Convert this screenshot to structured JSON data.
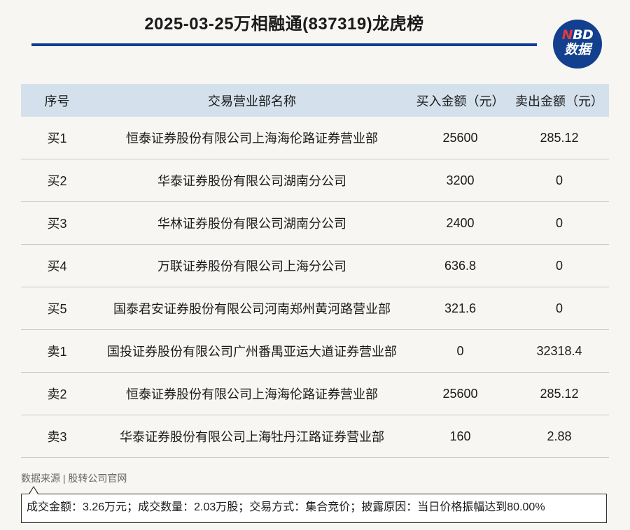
{
  "header": {
    "title": "2025-03-25万相融通(837319)龙虎榜"
  },
  "logo": {
    "line1_n": "N",
    "line1_rest": "BD",
    "line2": "数据"
  },
  "table": {
    "columns": [
      "序号",
      "交易营业部名称",
      "买入金额（元）",
      "卖出金额（元）"
    ],
    "rows": [
      {
        "rank": "买1",
        "name": "恒泰证券股份有限公司上海海伦路证券营业部",
        "buy": "25600",
        "sell": "285.12"
      },
      {
        "rank": "买2",
        "name": "华泰证券股份有限公司湖南分公司",
        "buy": "3200",
        "sell": "0"
      },
      {
        "rank": "买3",
        "name": "华林证券股份有限公司湖南分公司",
        "buy": "2400",
        "sell": "0"
      },
      {
        "rank": "买4",
        "name": "万联证券股份有限公司上海分公司",
        "buy": "636.8",
        "sell": "0"
      },
      {
        "rank": "买5",
        "name": "国泰君安证券股份有限公司河南郑州黄河路营业部",
        "buy": "321.6",
        "sell": "0"
      },
      {
        "rank": "卖1",
        "name": "国投证券股份有限公司广州番禺亚运大道证券营业部",
        "buy": "0",
        "sell": "32318.4"
      },
      {
        "rank": "卖2",
        "name": "恒泰证券股份有限公司上海海伦路证券营业部",
        "buy": "25600",
        "sell": "285.12"
      },
      {
        "rank": "卖3",
        "name": "华泰证券股份有限公司上海牡丹江路证券营业部",
        "buy": "160",
        "sell": "2.88"
      }
    ]
  },
  "footer": {
    "source": "数据来源 | 股转公司官网",
    "note": "成交金额：3.26万元；成交数量：2.03万股；交易方式：集合竞价；披露原因：当日价格振幅达到80.00%"
  },
  "colors": {
    "accent": "#0c3f94",
    "header_bg": "#d4e1ec",
    "page_bg": "#f8f6f3",
    "logo_red": "#e03a3e"
  }
}
